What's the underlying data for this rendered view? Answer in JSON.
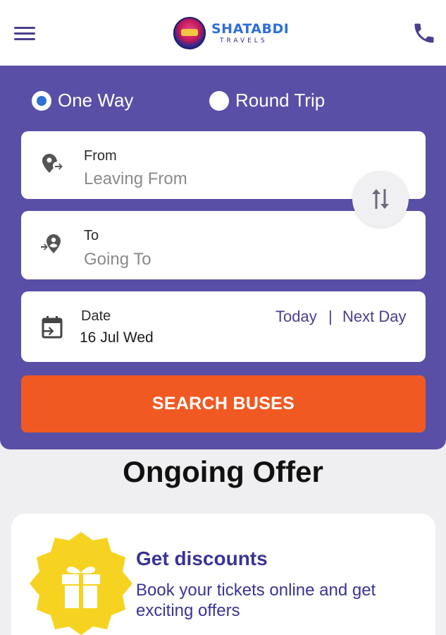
{
  "header": {
    "menu_icon": "hamburger-menu-icon",
    "logo": {
      "name": "SHATABDI",
      "sub": "TRAVELS"
    },
    "phone_icon": "phone-icon"
  },
  "search_form": {
    "trip_types": [
      {
        "label": "One Way",
        "selected": true
      },
      {
        "label": "Round Trip",
        "selected": false
      }
    ],
    "from": {
      "title": "From",
      "placeholder": "Leaving From",
      "icon": "depart-location-icon"
    },
    "to": {
      "title": "To",
      "placeholder": "Going To",
      "icon": "arrive-location-icon"
    },
    "swap_icon": "swap-vertical-icon",
    "date": {
      "title": "Date",
      "value": "16 Jul Wed",
      "icon": "calendar-icon",
      "today_label": "Today",
      "separator": "|",
      "next_day_label": "Next Day"
    },
    "search_button_label": "SEARCH BUSES"
  },
  "offers": {
    "heading": "Ongoing Offer",
    "items": [
      {
        "title": "Get discounts",
        "description": "Book your tickets online and get exciting offers",
        "icon": "gift-icon"
      }
    ]
  },
  "colors": {
    "panel": "#5a4fa6",
    "accent": "#f05a22",
    "radio_selected": "#2f6fd6",
    "badge": "#f5d320",
    "brand_text": "#3a3495"
  }
}
